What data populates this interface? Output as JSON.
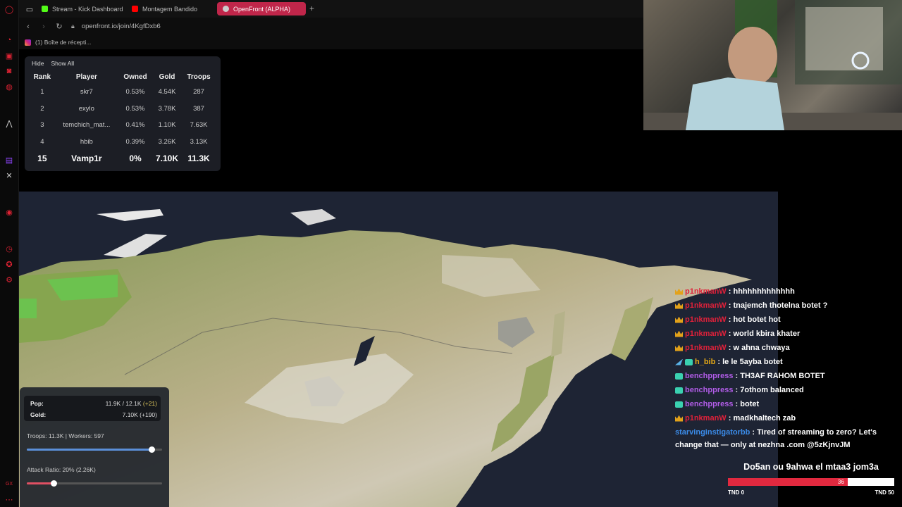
{
  "browser": {
    "tabs": [
      {
        "label": "Stream - Kick Dashboard",
        "icon": "kick-icon",
        "color": "#53fc18"
      },
      {
        "label": "Montagem Bandido",
        "icon": "youtube-icon",
        "color": "#ff0000"
      },
      {
        "label": "OpenFront (ALPHA)",
        "icon": "globe-icon",
        "color": "#cccccc"
      }
    ],
    "url": "openfront.io/join/4KgfDxb6",
    "bookmark": "(1) Boîte de récepti..."
  },
  "leaderboard": {
    "hide_label": "Hide",
    "show_all_label": "Show All",
    "columns": [
      "Rank",
      "Player",
      "Owned",
      "Gold",
      "Troops"
    ],
    "rows": [
      [
        "1",
        "skr7",
        "0.53%",
        "4.54K",
        "287"
      ],
      [
        "2",
        "exylo",
        "0.53%",
        "3.78K",
        "387"
      ],
      [
        "3",
        "temchich_mat...",
        "0.41%",
        "1.10K",
        "7.63K"
      ],
      [
        "4",
        "hbib",
        "0.39%",
        "3.26K",
        "3.13K"
      ]
    ],
    "me": [
      "15",
      "Vamp1r",
      "0%",
      "7.10K",
      "11.3K"
    ]
  },
  "control": {
    "pop_label": "Pop:",
    "pop_value": "11.9K / 12.1K",
    "pop_delta": "(+21)",
    "gold_label": "Gold:",
    "gold_value": "7.10K (+190)",
    "troops_line": "Troops: 11.3K | Workers: 597",
    "troops_ratio": 0.92,
    "attack_line": "Attack Ratio: 20% (2.26K)",
    "attack_ratio": 0.2
  },
  "chat": [
    {
      "badges": [
        "crown"
      ],
      "user": "p1nkmanW",
      "color": "#e0213a",
      "text": ": hhhhhhhhhhhhh"
    },
    {
      "badges": [
        "crown"
      ],
      "user": "p1nkmanW",
      "color": "#e0213a",
      "text": ": tnajemch thotelna botet ?"
    },
    {
      "badges": [
        "crown"
      ],
      "user": "p1nkmanW",
      "color": "#e0213a",
      "text": ": hot botet hot"
    },
    {
      "badges": [
        "crown"
      ],
      "user": "p1nkmanW",
      "color": "#e0213a",
      "text": ": world kbira khater"
    },
    {
      "badges": [
        "crown"
      ],
      "user": "p1nkmanW",
      "color": "#e0213a",
      "text": ": w ahna chwaya"
    },
    {
      "badges": [
        "pin",
        "gift"
      ],
      "user": "h_bib",
      "color": "#e6a916",
      "text": ": le le 5ayba botet"
    },
    {
      "badges": [
        "gift"
      ],
      "user": "benchppress",
      "color": "#b05ce6",
      "text": ": TH3AF RAHOM BOTET"
    },
    {
      "badges": [
        "gift"
      ],
      "user": "benchppress",
      "color": "#b05ce6",
      "text": ": 7othom balanced"
    },
    {
      "badges": [
        "gift"
      ],
      "user": "benchppress",
      "color": "#b05ce6",
      "text": ": botet"
    },
    {
      "badges": [
        "crown"
      ],
      "user": "p1nkmanW",
      "color": "#e0213a",
      "text": ": madkhaltech zab"
    },
    {
      "badges": [],
      "user": "starvinginstigatorbb",
      "color": "#3b8be8",
      "text": ": Tired of streaming to zero? Let's change that — only at nezhna .com @5zKjnvJM"
    }
  ],
  "goal": {
    "title": "Do5an ou 9ahwa el mtaa3 jom3a",
    "current": 36,
    "max": 50,
    "start_label": "TND 0",
    "end_label": "TND 50",
    "fill_color": "#e1293f"
  }
}
